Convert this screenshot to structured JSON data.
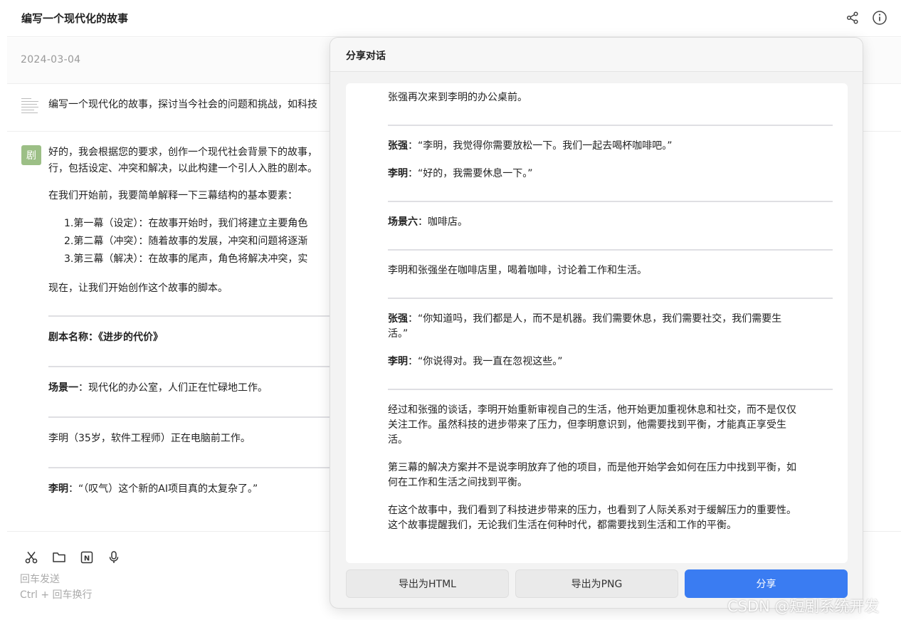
{
  "header": {
    "title": "编写一个现代化的故事",
    "share_icon": "share-icon",
    "info_icon": "info-icon"
  },
  "conversation": {
    "date": "2024-03-04",
    "prompt": "编写一个现代化的故事，探讨当今社会的问题和挑战，如科技",
    "avatar_label": "剧",
    "response": {
      "intro_line1": "好的，我会根据您的要求，创作一个现代社会背景下的故事，",
      "intro_line2": "行，包括设定、冲突和解决，以此构建一个引人入胜的剧本。",
      "before_start": "在我们开始前，我要简单解释一下三幕结构的基本要素：",
      "acts": [
        "1.第一幕（设定）：在故事开始时，我们将建立主要角色",
        "2.第二幕（冲突）：随着故事的发展，冲突和问题将逐渐",
        "3.第三幕（解决）：在故事的尾声，角色将解决冲突，实"
      ],
      "lets_start": "现在，让我们开始创作这个故事的脚本。",
      "script_name_label": "剧本名称：《进步的代价》",
      "scene1_label": "场景一",
      "scene1_text": "：现代化的办公室，人们正在忙碌地工作。",
      "liming_intro": "李明（35岁，软件工程师）正在电脑前工作。",
      "liming_label": "李明",
      "liming_line": "：“（叹气）这个新的AI项目真的太复杂了。”"
    }
  },
  "composer": {
    "tools": [
      "scissors-icon",
      "folder-icon",
      "notion-icon",
      "microphone-icon"
    ],
    "hint_send": "回车发送",
    "hint_newline": "Ctrl + 回车换行"
  },
  "share_dialog": {
    "title": "分享对话",
    "content": {
      "p1": "张强再次来到李明的办公桌前。",
      "zq1_label": "张强",
      "zq1_text": "：“李明，我觉得你需要放松一下。我们一起去喝杯咖啡吧。”",
      "lm1_label": "李明",
      "lm1_text": "：“好的，我需要休息一下。”",
      "scene6_label": "场景六",
      "scene6_text": "：咖啡店。",
      "p2": "李明和张强坐在咖啡店里，喝着咖啡，讨论着工作和生活。",
      "zq2_label": "张强",
      "zq2_line1": "：“你知道吗，我们都是人，而不是机器。我们需要休息，我们需要社交，我们需要生",
      "zq2_line2": "活。”",
      "lm2_label": "李明",
      "lm2_text": "：“你说得对。我一直在忽视这些。”",
      "p3_line1": "经过和张强的谈话，李明开始重新审视自己的生活，他开始更加重视休息和社交，而不是仅仅",
      "p3_line2": "关注工作。虽然科技的进步带来了压力，但李明意识到，他需要找到平衡，才能真正享受生",
      "p3_line3": "活。",
      "p4_line1": "第三幕的解决方案并不是说李明放弃了他的项目，而是他开始学会如何在压力中找到平衡，如",
      "p4_line2": "何在工作和生活之间找到平衡。",
      "p5_line1": "在这个故事中，我们看到了科技进步带来的压力，也看到了人际关系对于缓解压力的重要性。",
      "p5_line2": "这个故事提醒我们，无论我们生活在何种时代，都需要找到生活和工作的平衡。"
    },
    "buttons": {
      "export_html": "导出为HTML",
      "export_png": "导出为PNG",
      "share": "分享"
    }
  },
  "watermark": "CSDN @短剧系统开发"
}
